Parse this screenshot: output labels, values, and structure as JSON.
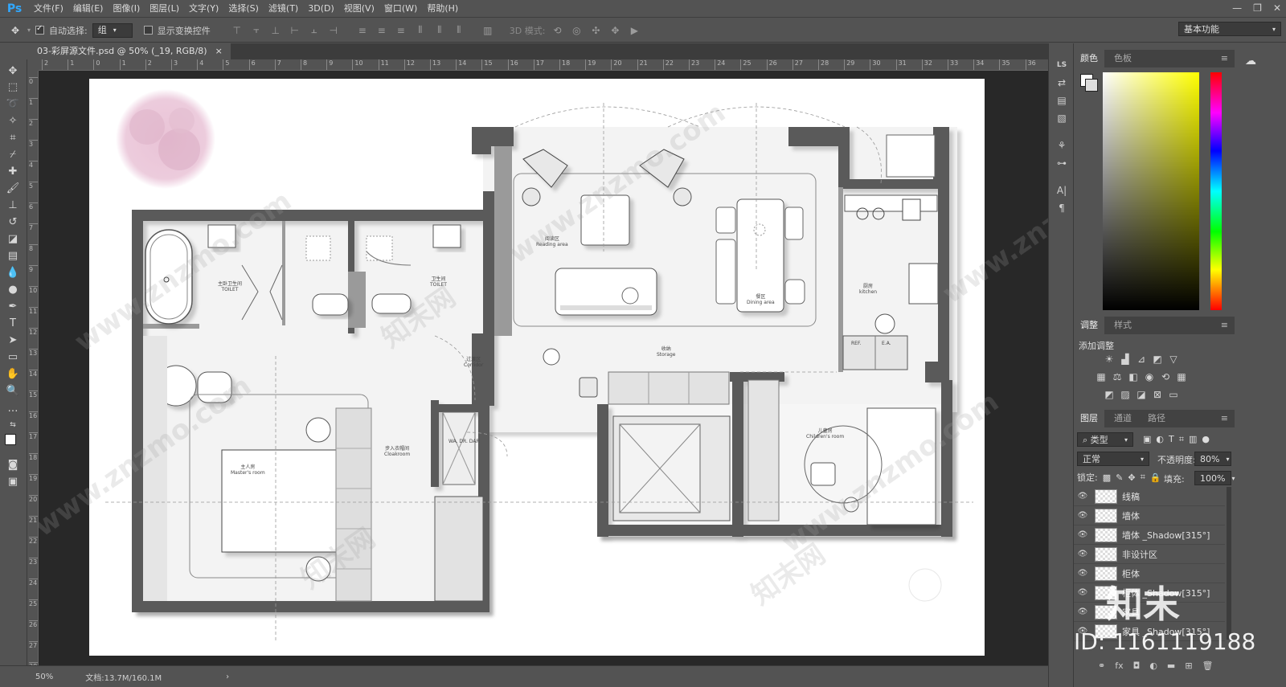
{
  "app": {
    "logo": "Ps"
  },
  "menu": [
    "文件(F)",
    "编辑(E)",
    "图像(I)",
    "图层(L)",
    "文字(Y)",
    "选择(S)",
    "滤镜(T)",
    "3D(D)",
    "视图(V)",
    "窗口(W)",
    "帮助(H)"
  ],
  "window_controls": [
    "—",
    "❐",
    "✕"
  ],
  "options": {
    "auto_select_label": "自动选择:",
    "auto_select_value": "组",
    "auto_select_checked": true,
    "show_transform_label": "显示变换控件",
    "show_transform_checked": false,
    "mode_3d_label": "3D 模式:",
    "workspace": "基本功能"
  },
  "document": {
    "tab_title": "03-彩屏源文件.psd @ 50% (_19, RGB/8)",
    "tab_close": "×",
    "zoom": "50%",
    "doc_info": "文档:13.7M/160.1M",
    "status_arrow": "›"
  },
  "ruler": {
    "top_ticks": [
      "2",
      "1",
      "0",
      "1",
      "2",
      "3",
      "4",
      "5",
      "6",
      "7",
      "8",
      "9",
      "10",
      "11",
      "12",
      "13",
      "14",
      "15",
      "16",
      "17",
      "18",
      "19",
      "20",
      "21",
      "22",
      "23",
      "24",
      "25",
      "26",
      "27",
      "28",
      "29",
      "30",
      "31",
      "32",
      "33",
      "34",
      "35",
      "36"
    ],
    "left_ticks": [
      "0",
      "1",
      "2",
      "3",
      "4",
      "5",
      "6",
      "7",
      "8",
      "9",
      "10",
      "11",
      "12",
      "13",
      "14",
      "15",
      "16",
      "17",
      "18",
      "19",
      "20",
      "21",
      "22",
      "23",
      "24",
      "25",
      "26",
      "27",
      "28"
    ]
  },
  "floorplan": {
    "rooms": [
      {
        "cn": "主卧卫生间",
        "en": "TOILET"
      },
      {
        "cn": "卫生间",
        "en": "TOILET"
      },
      {
        "cn": "阅读区",
        "en": "Reading area"
      },
      {
        "cn": "餐区",
        "en": "Dining area"
      },
      {
        "cn": "厨房",
        "en": "kitchen"
      },
      {
        "cn": "过渡区",
        "en": "Corridor"
      },
      {
        "cn": "收纳",
        "en": "Storage"
      },
      {
        "cn": "主人房",
        "en": "Master's room"
      },
      {
        "cn": "步入衣帽间",
        "en": "Cloakroom"
      },
      {
        "cn": "儿童房",
        "en": "Children's room"
      }
    ],
    "fridge_label": "REF.",
    "ea_label": "E.A.",
    "wash_label": "WA. DR. DAR"
  },
  "watermarks": {
    "site": "www.znzmo.com",
    "brand": "知末网",
    "logo": "知末",
    "id": "ID: 1161119188"
  },
  "color_panel": {
    "tabs": [
      "颜色",
      "色板"
    ]
  },
  "adjust_panel": {
    "tabs": [
      "调整",
      "样式"
    ],
    "title": "添加调整"
  },
  "layers_panel": {
    "tabs": [
      "图层",
      "通道",
      "路径"
    ],
    "filter": "类型",
    "blend_mode": "正常",
    "opacity_label": "不透明度:",
    "opacity": "80%",
    "lock_label": "锁定:",
    "fill_label": "填充:",
    "fill": "100%",
    "layers": [
      "线稿",
      "墙体",
      "墙体 _Shadow[315°]",
      "非设计区",
      "柜体",
      "柜体 _Shadow[315°]",
      "家具",
      "家具 _Shadow[315°]"
    ],
    "footer_fx": "fx"
  },
  "colors": {
    "accent": "#31a8ff",
    "wall": "#5a5a5a",
    "floor": "#f2f2f2",
    "blossom": "#e6b8d2"
  }
}
